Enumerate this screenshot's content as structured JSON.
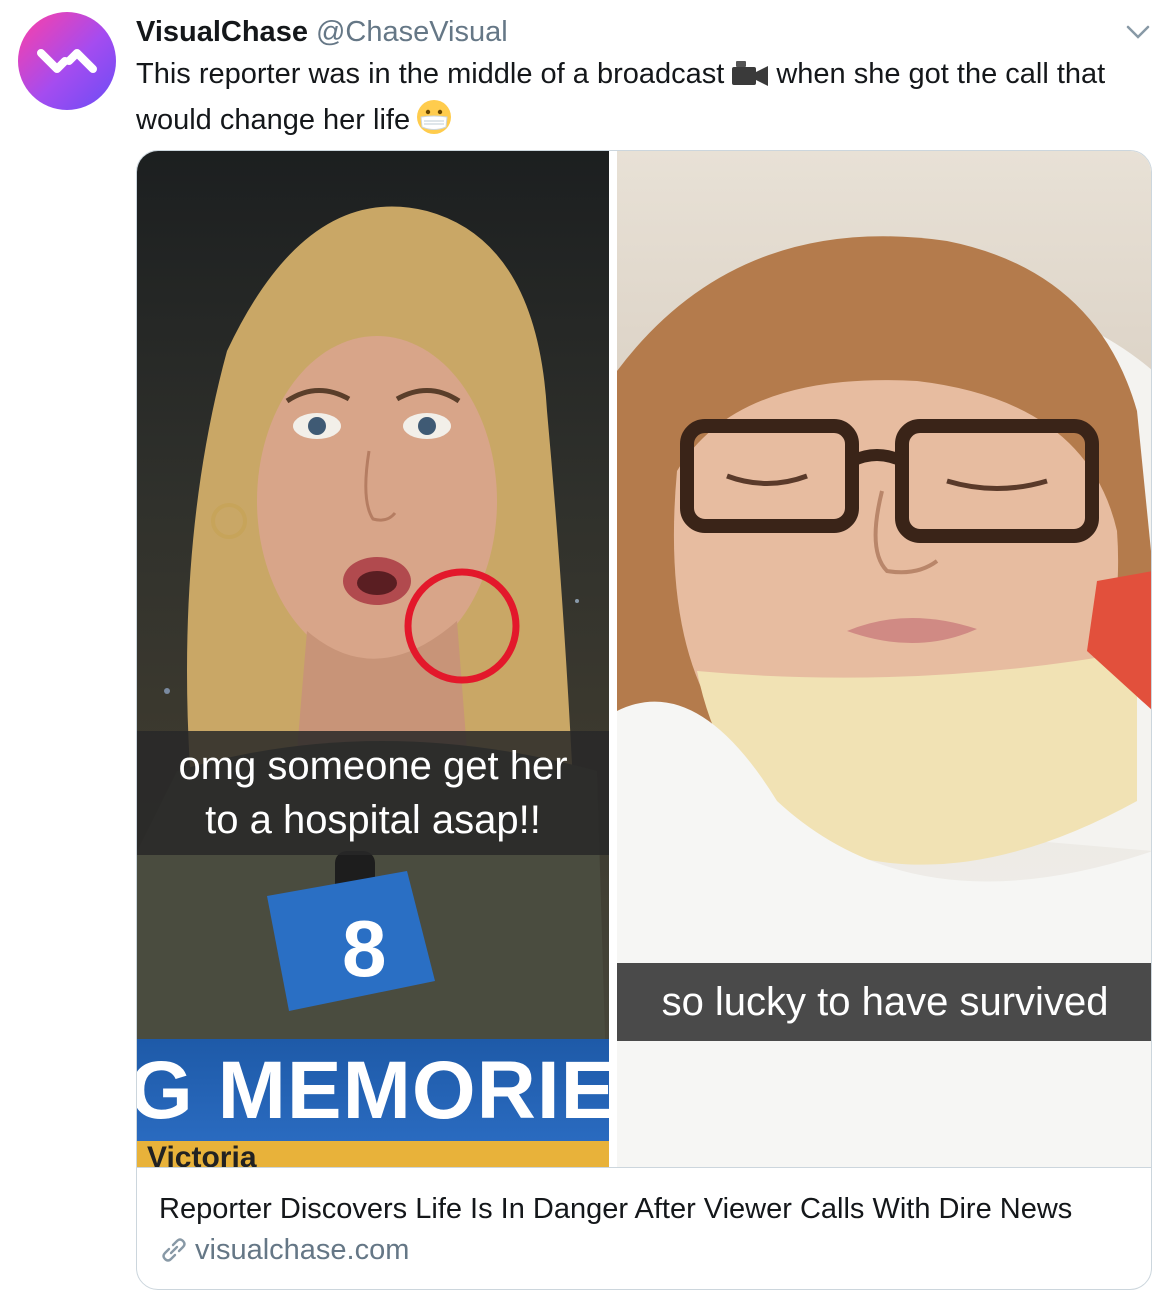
{
  "tweet": {
    "display_name": "VisualChase",
    "handle": "@ChaseVisual",
    "text_part1": "This reporter was in the middle of a broadcast",
    "text_part2": "when she got the call that would change her life",
    "emoji_1": "video-camera-icon",
    "emoji_2": "face-with-medical-mask-icon"
  },
  "card": {
    "left_caption_line1": "omg someone get her",
    "left_caption_line2": "to a hospital asap!!",
    "right_caption": "so lucky to have survived",
    "banner_text": "G MEMORIE",
    "banner_subtext": "Victoria",
    "mic_flag_text": "8",
    "title": "Reporter Discovers Life Is In Danger After Viewer Calls With Dire News",
    "domain": "visualchase.com"
  },
  "colors": {
    "avatar_gradient_start": "#ff3fa4",
    "avatar_gradient_end": "#6a4df5",
    "circle_highlight": "#e3182b",
    "muted_text": "#657786"
  }
}
